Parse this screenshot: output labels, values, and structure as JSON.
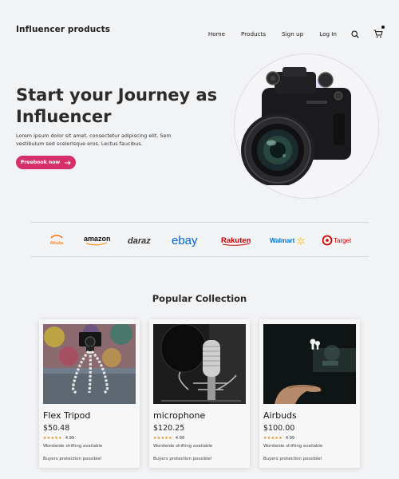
{
  "header": {
    "brand": "Influencer products",
    "nav": [
      "Home",
      "Products",
      "Sign up",
      "Log In"
    ]
  },
  "hero": {
    "title": "Start your Journey as Influencer",
    "description": "Lorem ipsum dolor sit amet, consectetur adipiscing elit. Sem vestibulum sed scelerisque eros. Lectus faucibus.",
    "cta_label": "Preebook now",
    "accent_color": "#d6306a"
  },
  "partners": [
    {
      "name": "Alibaba",
      "color": "#ff6a00"
    },
    {
      "name": "amazon",
      "color": "#111111"
    },
    {
      "name": "daraz",
      "color": "#333333"
    },
    {
      "name": "ebay",
      "color": "#0064d2"
    },
    {
      "name": "Rakuten",
      "color": "#bf0000"
    },
    {
      "name": "Walmart",
      "color": "#0071ce"
    },
    {
      "name": "Target",
      "color": "#cc0000"
    }
  ],
  "collection": {
    "title": "Popular Collection",
    "products": [
      {
        "name": "Flex Tripod",
        "price": "$50.48",
        "rating": "4.99",
        "shipping": "Wordwide shifting available",
        "protection": "Buyers protection possible!"
      },
      {
        "name": "microphone",
        "price": "$120.25",
        "rating": "4.99",
        "shipping": "Wordwide shifting available",
        "protection": "Buyers protection possible!"
      },
      {
        "name": "Airbuds",
        "price": "$100.00",
        "rating": "4.99",
        "shipping": "Wordwide shifting available",
        "protection": "Buyers protection possible!"
      }
    ]
  }
}
